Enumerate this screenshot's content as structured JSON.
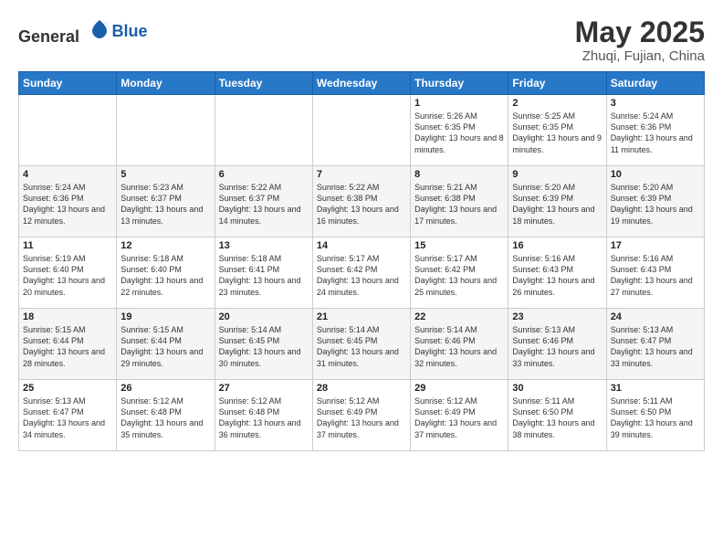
{
  "logo": {
    "general": "General",
    "blue": "Blue"
  },
  "title": "May 2025",
  "subtitle": "Zhuqi, Fujian, China",
  "weekdays": [
    "Sunday",
    "Monday",
    "Tuesday",
    "Wednesday",
    "Thursday",
    "Friday",
    "Saturday"
  ],
  "weeks": [
    [
      {
        "day": "",
        "info": ""
      },
      {
        "day": "",
        "info": ""
      },
      {
        "day": "",
        "info": ""
      },
      {
        "day": "",
        "info": ""
      },
      {
        "day": "1",
        "info": "Sunrise: 5:26 AM\nSunset: 6:35 PM\nDaylight: 13 hours and 8 minutes."
      },
      {
        "day": "2",
        "info": "Sunrise: 5:25 AM\nSunset: 6:35 PM\nDaylight: 13 hours and 9 minutes."
      },
      {
        "day": "3",
        "info": "Sunrise: 5:24 AM\nSunset: 6:36 PM\nDaylight: 13 hours and 11 minutes."
      }
    ],
    [
      {
        "day": "4",
        "info": "Sunrise: 5:24 AM\nSunset: 6:36 PM\nDaylight: 13 hours and 12 minutes."
      },
      {
        "day": "5",
        "info": "Sunrise: 5:23 AM\nSunset: 6:37 PM\nDaylight: 13 hours and 13 minutes."
      },
      {
        "day": "6",
        "info": "Sunrise: 5:22 AM\nSunset: 6:37 PM\nDaylight: 13 hours and 14 minutes."
      },
      {
        "day": "7",
        "info": "Sunrise: 5:22 AM\nSunset: 6:38 PM\nDaylight: 13 hours and 16 minutes."
      },
      {
        "day": "8",
        "info": "Sunrise: 5:21 AM\nSunset: 6:38 PM\nDaylight: 13 hours and 17 minutes."
      },
      {
        "day": "9",
        "info": "Sunrise: 5:20 AM\nSunset: 6:39 PM\nDaylight: 13 hours and 18 minutes."
      },
      {
        "day": "10",
        "info": "Sunrise: 5:20 AM\nSunset: 6:39 PM\nDaylight: 13 hours and 19 minutes."
      }
    ],
    [
      {
        "day": "11",
        "info": "Sunrise: 5:19 AM\nSunset: 6:40 PM\nDaylight: 13 hours and 20 minutes."
      },
      {
        "day": "12",
        "info": "Sunrise: 5:18 AM\nSunset: 6:40 PM\nDaylight: 13 hours and 22 minutes."
      },
      {
        "day": "13",
        "info": "Sunrise: 5:18 AM\nSunset: 6:41 PM\nDaylight: 13 hours and 23 minutes."
      },
      {
        "day": "14",
        "info": "Sunrise: 5:17 AM\nSunset: 6:42 PM\nDaylight: 13 hours and 24 minutes."
      },
      {
        "day": "15",
        "info": "Sunrise: 5:17 AM\nSunset: 6:42 PM\nDaylight: 13 hours and 25 minutes."
      },
      {
        "day": "16",
        "info": "Sunrise: 5:16 AM\nSunset: 6:43 PM\nDaylight: 13 hours and 26 minutes."
      },
      {
        "day": "17",
        "info": "Sunrise: 5:16 AM\nSunset: 6:43 PM\nDaylight: 13 hours and 27 minutes."
      }
    ],
    [
      {
        "day": "18",
        "info": "Sunrise: 5:15 AM\nSunset: 6:44 PM\nDaylight: 13 hours and 28 minutes."
      },
      {
        "day": "19",
        "info": "Sunrise: 5:15 AM\nSunset: 6:44 PM\nDaylight: 13 hours and 29 minutes."
      },
      {
        "day": "20",
        "info": "Sunrise: 5:14 AM\nSunset: 6:45 PM\nDaylight: 13 hours and 30 minutes."
      },
      {
        "day": "21",
        "info": "Sunrise: 5:14 AM\nSunset: 6:45 PM\nDaylight: 13 hours and 31 minutes."
      },
      {
        "day": "22",
        "info": "Sunrise: 5:14 AM\nSunset: 6:46 PM\nDaylight: 13 hours and 32 minutes."
      },
      {
        "day": "23",
        "info": "Sunrise: 5:13 AM\nSunset: 6:46 PM\nDaylight: 13 hours and 33 minutes."
      },
      {
        "day": "24",
        "info": "Sunrise: 5:13 AM\nSunset: 6:47 PM\nDaylight: 13 hours and 33 minutes."
      }
    ],
    [
      {
        "day": "25",
        "info": "Sunrise: 5:13 AM\nSunset: 6:47 PM\nDaylight: 13 hours and 34 minutes."
      },
      {
        "day": "26",
        "info": "Sunrise: 5:12 AM\nSunset: 6:48 PM\nDaylight: 13 hours and 35 minutes."
      },
      {
        "day": "27",
        "info": "Sunrise: 5:12 AM\nSunset: 6:48 PM\nDaylight: 13 hours and 36 minutes."
      },
      {
        "day": "28",
        "info": "Sunrise: 5:12 AM\nSunset: 6:49 PM\nDaylight: 13 hours and 37 minutes."
      },
      {
        "day": "29",
        "info": "Sunrise: 5:12 AM\nSunset: 6:49 PM\nDaylight: 13 hours and 37 minutes."
      },
      {
        "day": "30",
        "info": "Sunrise: 5:11 AM\nSunset: 6:50 PM\nDaylight: 13 hours and 38 minutes."
      },
      {
        "day": "31",
        "info": "Sunrise: 5:11 AM\nSunset: 6:50 PM\nDaylight: 13 hours and 39 minutes."
      }
    ]
  ]
}
